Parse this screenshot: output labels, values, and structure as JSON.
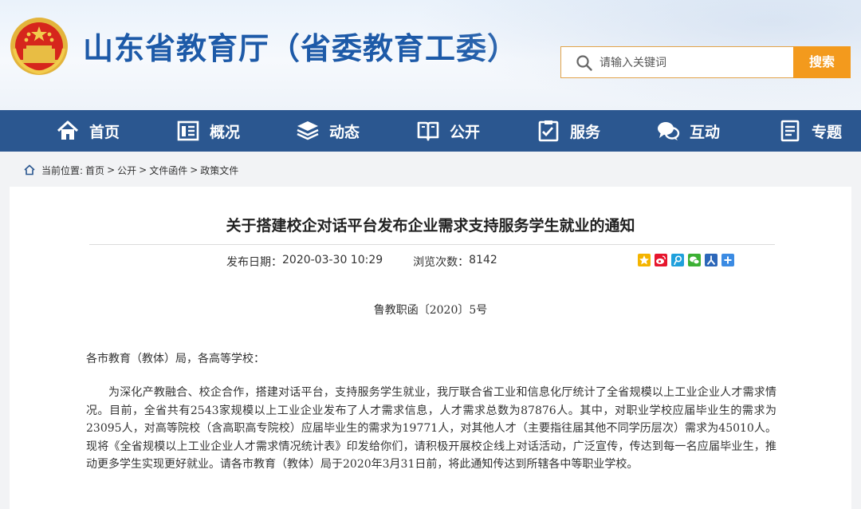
{
  "header": {
    "site_title": "山东省教育厅（省委教育工委）",
    "search_placeholder": "请输入关键词",
    "search_button": "搜索"
  },
  "nav": {
    "items": [
      {
        "label": "首页",
        "icon": "home-icon"
      },
      {
        "label": "概况",
        "icon": "building-icon"
      },
      {
        "label": "动态",
        "icon": "stack-icon"
      },
      {
        "label": "公开",
        "icon": "book-icon"
      },
      {
        "label": "服务",
        "icon": "clipboard-icon"
      },
      {
        "label": "互动",
        "icon": "chat-icon"
      },
      {
        "label": "专题",
        "icon": "document-icon"
      }
    ]
  },
  "breadcrumb": {
    "prefix": "当前位置:",
    "items": [
      "首页",
      "公开",
      "文件函件",
      "政策文件"
    ],
    "separator": ">"
  },
  "article": {
    "title": "关于搭建校企对话平台发布企业需求支持服务学生就业的通知",
    "date_label": "发布日期：",
    "date": "2020-03-30 10:29",
    "views_label": "浏览次数：",
    "views": "8142",
    "doc_number": "鲁教职函〔2020〕5号",
    "addressee": "各市教育（教体）局，各高等学校：",
    "paragraph1": "为深化产教融合、校企合作，搭建对话平台，支持服务学生就业，我厅联合省工业和信息化厅统计了全省规模以上工业企业人才需求情况。目前，全省共有2543家规模以上工业企业发布了人才需求信息，人才需求总数为87876人。其中，对职业学校应届毕业生的需求为23095人，对高等院校（含高职高专院校）应届毕业生的需求为19771人，对其他人才（主要指往届其他不同学历层次）需求为45010人。现将《全省规模以上工业企业人才需求情况统计表》印发给你们，请积极开展校企线上对话活动，广泛宣传，传达到每一名应届毕业生，推动更多学生实现更好就业。请各市教育（教体）局于2020年3月31日前，将此通知传达到所辖各中等职业学校。"
  },
  "share_icons": [
    "qzone-icon",
    "weibo-icon",
    "tencent-weibo-icon",
    "wechat-icon",
    "renren-icon",
    "more-share-icon"
  ],
  "colors": {
    "brand_blue": "#1d5aa8",
    "nav_bg": "#2b5790",
    "search_orange": "#f39a1d",
    "page_bg": "#f2f3f5"
  }
}
